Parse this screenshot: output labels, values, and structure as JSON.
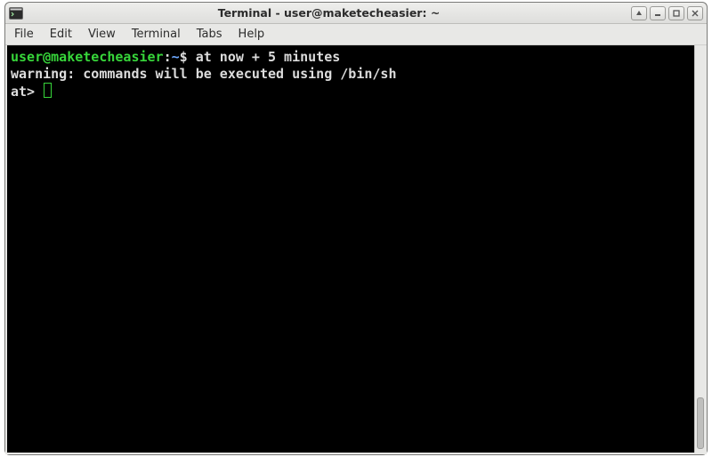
{
  "window": {
    "title": "Terminal - user@maketecheasier: ~"
  },
  "menubar": {
    "items": [
      "File",
      "Edit",
      "View",
      "Terminal",
      "Tabs",
      "Help"
    ]
  },
  "prompt": {
    "user_host": "user@maketecheasier",
    "separator": ":",
    "cwd": "~",
    "symbol": "$"
  },
  "terminal": {
    "command": "at now + 5 minutes",
    "warning_line": "warning: commands will be executed using /bin/sh",
    "at_prompt": "at> "
  },
  "icons": {
    "app": "terminal-icon",
    "up": "arrow-up-icon",
    "minimize": "minimize-icon",
    "maximize": "maximize-icon",
    "close": "close-icon"
  }
}
